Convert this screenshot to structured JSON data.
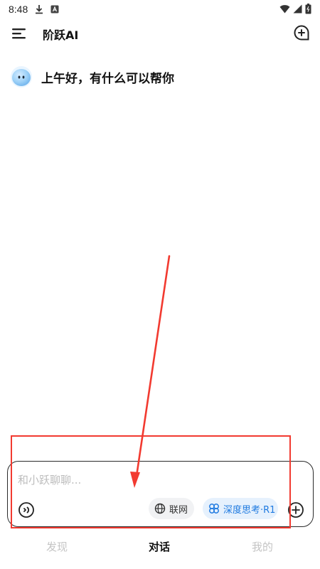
{
  "status_bar": {
    "time": "8:48",
    "icons": [
      "download-icon",
      "a-icon",
      "wifi-icon",
      "cellular-icon",
      "battery-icon"
    ]
  },
  "header": {
    "title": "阶跃AI",
    "icons": [
      "menu-icon",
      "new-chat-icon"
    ]
  },
  "greeting": {
    "text": "上午好，有什么可以帮你"
  },
  "input": {
    "value": "",
    "placeholder": "和小跃聊聊...",
    "chips": [
      {
        "label": "联网",
        "icon": "globe-icon"
      },
      {
        "label": "深度思考·R1",
        "icon": "deep-think-icon",
        "accent": "#1f7ae0"
      }
    ]
  },
  "bottom_nav": {
    "tabs": [
      {
        "label": "发现",
        "active": false
      },
      {
        "label": "对话",
        "active": true
      },
      {
        "label": "我的",
        "active": false
      }
    ]
  },
  "colors": {
    "accent": "#1f7ae0",
    "annotation": "#f23a30",
    "chip_bg": "#e6f1fd"
  }
}
